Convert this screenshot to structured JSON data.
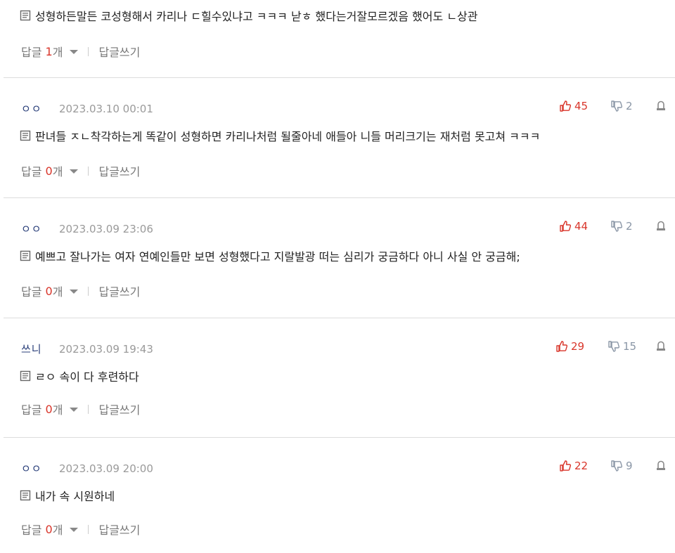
{
  "comments": [
    {
      "author": "",
      "date": "",
      "likes": "",
      "dislikes": "",
      "body": "성형하든말든 코성형해서 카리나 ㄷ힐수있냐고 ㅋㅋㅋ 낟ㅎ 했다는거잘모르겠음 했어도 ㄴ상관",
      "reply_label": "답글",
      "reply_count": "1",
      "reply_unit": "개",
      "write_label": "답글쓰기"
    },
    {
      "author": "ㅇㅇ",
      "date": "2023.03.10 00:01",
      "likes": "45",
      "dislikes": "2",
      "body": "판녀들 ㅈㄴ착각하는게 똑같이 성형하면 카리나처럼 될줄아네 애들아 니들 머리크기는 재처럼 못고쳐 ㅋㅋㅋ",
      "reply_label": "답글",
      "reply_count": "0",
      "reply_unit": "개",
      "write_label": "답글쓰기"
    },
    {
      "author": "ㅇㅇ",
      "date": "2023.03.09 23:06",
      "likes": "44",
      "dislikes": "2",
      "body": "예쁘고 잘나가는 여자 연예인들만 보면 성형했다고 지랄발광 떠는 심리가 궁금하다 아니 사실 안 궁금해;",
      "reply_label": "답글",
      "reply_count": "0",
      "reply_unit": "개",
      "write_label": "답글쓰기"
    },
    {
      "author": "쓰니",
      "date": "2023.03.09 19:43",
      "likes": "29",
      "dislikes": "15",
      "body": "ㄹㅇ 속이 다 후련하다",
      "reply_label": "답글",
      "reply_count": "0",
      "reply_unit": "개",
      "write_label": "답글쓰기"
    },
    {
      "author": "ㅇㅇ",
      "date": "2023.03.09 20:00",
      "likes": "22",
      "dislikes": "9",
      "body": "내가 속 시원하네",
      "reply_label": "답글",
      "reply_count": "0",
      "reply_unit": "개",
      "write_label": "답글쓰기"
    }
  ],
  "icons": {
    "like": "thumbs-up-icon",
    "dislike": "thumbs-down-icon",
    "report": "report-icon",
    "body": "document-icon",
    "reply_toggle": "chevron-down-icon"
  },
  "colors": {
    "accent_red": "#d9362b",
    "author": "#2a3f7a",
    "muted": "#9a9a9a",
    "divider": "#dcdcdc"
  }
}
